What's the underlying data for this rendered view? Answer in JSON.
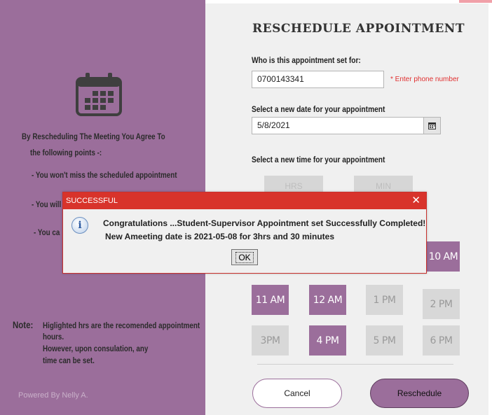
{
  "left_panel": {
    "intro_line1": "By Rescheduling The Meeting You Agree To",
    "intro_line2": "the following points -:",
    "point1": "- You won't miss the scheduled appointment",
    "point2_partial": "- You will",
    "point3_partial": "- You ca",
    "note_label": "Note:",
    "note_line1": "Higlighted hrs are the recomended appointment",
    "note_line2": "hours.",
    "note_line3": "However, upon consulation, any",
    "note_line4": "time can be set.",
    "powered_by": "Powered By Nelly A."
  },
  "form": {
    "title": "RESCHEDULE APPOINTMENT",
    "who_label": "Who is this appointment set for:",
    "phone_value": "0700143341",
    "phone_hint": "* Enter phone number",
    "date_label": "Select a new date for your appointment",
    "date_value": "5/8/2021",
    "time_label": "Select a new time for your appointment",
    "hrs_label": "HRS",
    "min_label": "MIN",
    "slots": {
      "s10am": "10 AM",
      "s11am": "11 AM",
      "s12am": "12 AM",
      "s1pm": "1 PM",
      "s2pm": "2 PM",
      "s3pm": "3PM",
      "s4pm": "4 PM",
      "s5pm": "5 PM",
      "s6pm": "6 PM"
    },
    "cancel_label": "Cancel",
    "reschedule_label": "Reschedule"
  },
  "dialog": {
    "title": "SUCCESSFUL",
    "close": "✕",
    "message_line1": "Congratulations ...Student-Supervisor Appointment set Successfully Completed!",
    "message_line2": "New Ameeting date is 2021-05-08 for 3hrs and 30 minutes",
    "ok_label": "OK",
    "info_glyph": "i"
  },
  "colors": {
    "accent": "#9b6e9b",
    "dialog_title_bar": "#d8332b",
    "hint": "#e03030"
  },
  "icons": {
    "calendar": "calendar-icon",
    "date_picker": "calendar-small-icon",
    "info": "info-icon",
    "close": "close-icon"
  }
}
